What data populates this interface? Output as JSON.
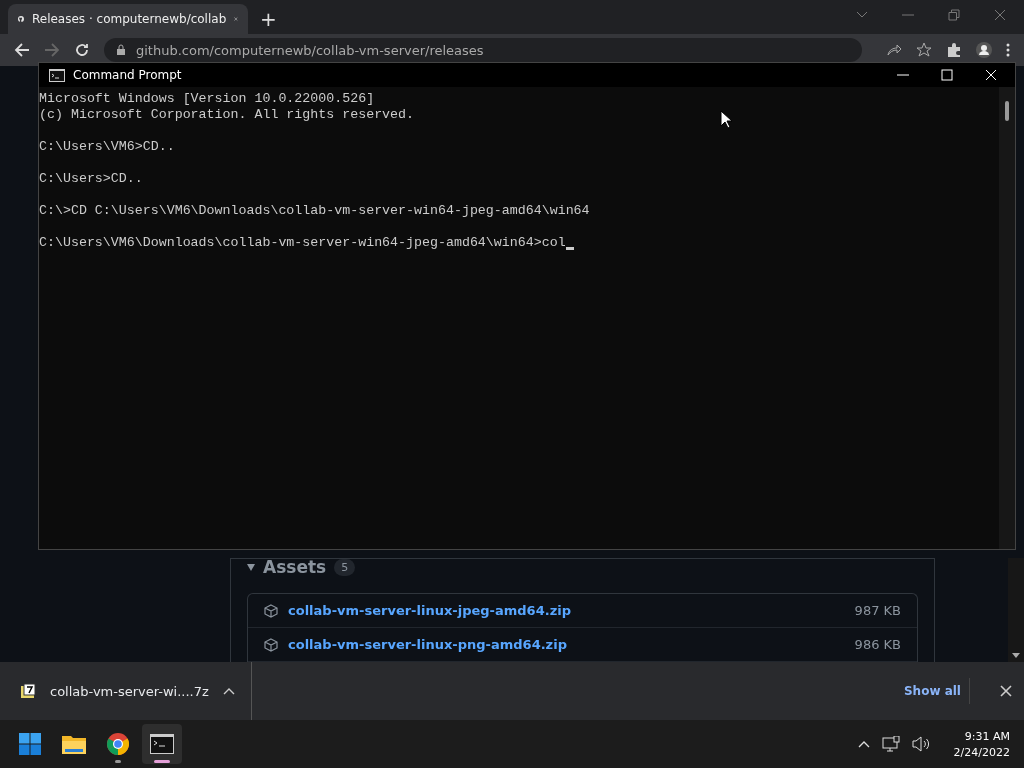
{
  "browser": {
    "tab": {
      "title": "Releases · computernewb/collab",
      "selected": true
    },
    "new_tab": "+",
    "address": "github.com/computernewb/collab-vm-server/releases"
  },
  "assets": {
    "heading": "Assets",
    "count": "5",
    "files": [
      {
        "name": "collab-vm-server-linux-jpeg-amd64.zip",
        "size": "987 KB"
      },
      {
        "name": "collab-vm-server-linux-png-amd64.zip",
        "size": "986 KB"
      }
    ]
  },
  "command_prompt": {
    "title": "Command Prompt",
    "paragraphs": [
      [
        "Microsoft Windows [Version 10.0.22000.526]",
        "(c) Microsoft Corporation. All rights reserved."
      ],
      [
        "C:\\Users\\VM6>CD.."
      ],
      [
        "C:\\Users>CD.."
      ],
      [
        "C:\\>CD C:\\Users\\VM6\\Downloads\\collab-vm-server-win64-jpeg-amd64\\win64"
      ],
      [
        "C:\\Users\\VM6\\Downloads\\collab-vm-server-win64-jpeg-amd64\\win64>col"
      ]
    ],
    "cursor": true
  },
  "downloads": {
    "file": "collab-vm-server-wi....7z",
    "show_all": "Show all"
  },
  "taskbar": {
    "apps": [
      {
        "kind": "start",
        "running": false,
        "selected": false
      },
      {
        "kind": "explorer",
        "running": false,
        "selected": false
      },
      {
        "kind": "chrome",
        "running": true,
        "selected": false
      },
      {
        "kind": "terminal",
        "running": true,
        "selected": true
      }
    ],
    "time": "9:31 AM",
    "date": "2/24/2022"
  }
}
